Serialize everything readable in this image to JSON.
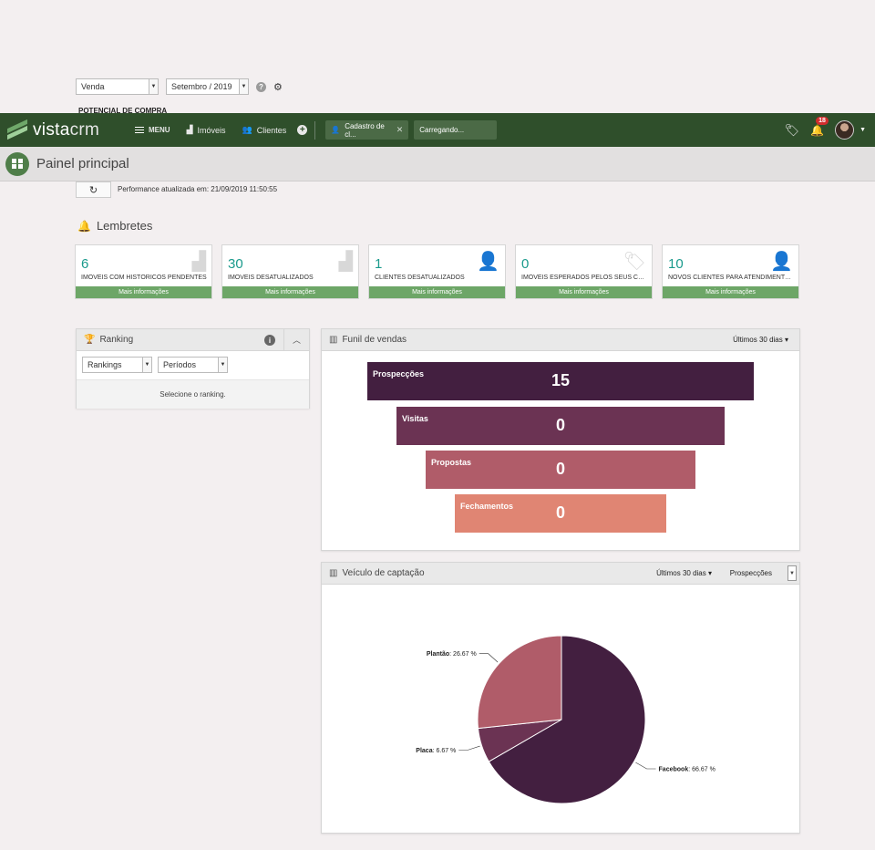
{
  "filters": {
    "tipo": "Venda",
    "mes": "Setembro / 2019",
    "potencial_label": "POTENCIAL DE COMPRA"
  },
  "navbar": {
    "logo_bold": "vista",
    "logo_thin": "crm",
    "menu_label": "MENU",
    "imoveis_label": "Imóveis",
    "clientes_label": "Clientes",
    "tab1_label": "Cadastro de cl...",
    "tab2_label": "Carregando...",
    "notif_count": "18"
  },
  "page": {
    "title": "Painel principal",
    "performance_text": "Performance atualizada em: 21/09/2019 11:50:55"
  },
  "lembretes": {
    "title": "Lembretes",
    "more_label": "Mais informações",
    "cards": [
      {
        "value": "6",
        "label": "IMÓVEIS COM HISTÓRICOS PENDENTES",
        "icon": "building-icon"
      },
      {
        "value": "30",
        "label": "IMÓVEIS DESATUALIZADOS",
        "icon": "building-icon"
      },
      {
        "value": "1",
        "label": "CLIENTES DESATUALIZADOS",
        "icon": "user-money-icon"
      },
      {
        "value": "0",
        "label": "IMÓVEIS ESPERADOS PELOS SEUS CLIENTES",
        "icon": "tag-icon"
      },
      {
        "value": "10",
        "label": "NOVOS CLIENTES PARA ATENDIMENTOS",
        "icon": "user-money-icon"
      }
    ]
  },
  "ranking": {
    "title": "Ranking",
    "select1": "Rankings",
    "select2": "Períodos",
    "empty_text": "Selecione o ranking."
  },
  "funil": {
    "title": "Funil de vendas",
    "period": "Últimos 30 dias",
    "stages": [
      {
        "label": "Prospecções",
        "value": "15",
        "color": "#431f40"
      },
      {
        "label": "Visitas",
        "value": "0",
        "color": "#6b3353"
      },
      {
        "label": "Propostas",
        "value": "0",
        "color": "#b05c69"
      },
      {
        "label": "Fechamentos",
        "value": "0",
        "color": "#e08573"
      }
    ]
  },
  "veiculo": {
    "title": "Veículo de captação",
    "period": "Últimos 30 dias",
    "filter": "Prospecções"
  },
  "chart_data": {
    "type": "pie",
    "title": "",
    "slices": [
      {
        "name": "Facebook",
        "value": 66.67,
        "label": "66.67 %",
        "color": "#431f40"
      },
      {
        "name": "Placa",
        "value": 6.67,
        "label": "6.67 %",
        "color": "#6b3353"
      },
      {
        "name": "Plantão",
        "value": 26.67,
        "label": "26.67 %",
        "color": "#b05c69"
      }
    ]
  }
}
